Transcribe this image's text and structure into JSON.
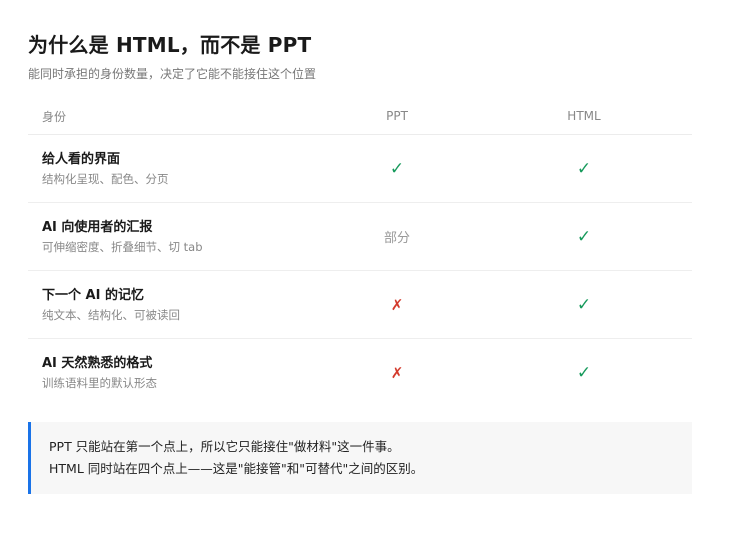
{
  "title": "为什么是 HTML，而不是 PPT",
  "subtitle": "能同时承担的身份数量，决定了它能不能接住这个位置",
  "table": {
    "headers": [
      "身份",
      "PPT",
      "HTML"
    ],
    "rows": [
      {
        "title": "给人看的界面",
        "desc": "结构化呈现、配色、分页",
        "ppt": "✓",
        "ppt_status": "yes",
        "html": "✓",
        "html_status": "yes"
      },
      {
        "title": "AI 向使用者的汇报",
        "desc": "可伸缩密度、折叠细节、切 tab",
        "ppt": "部分",
        "ppt_status": "partial",
        "html": "✓",
        "html_status": "yes"
      },
      {
        "title": "下一个 AI 的记忆",
        "desc": "纯文本、结构化、可被读回",
        "ppt": "✗",
        "ppt_status": "no",
        "html": "✓",
        "html_status": "yes"
      },
      {
        "title": "AI 天然熟悉的格式",
        "desc": "训练语料里的默认形态",
        "ppt": "✗",
        "ppt_status": "no",
        "html": "✓",
        "html_status": "yes"
      }
    ]
  },
  "callout": {
    "line1": "PPT 只能站在第一个点上，所以它只能接住\"做材料\"这一件事。",
    "line2": "HTML 同时站在四个点上——这是\"能接管\"和\"可替代\"之间的区别。"
  },
  "colors": {
    "yes": "#179a5c",
    "no": "#d33a2c",
    "accent": "#1a73e8"
  }
}
